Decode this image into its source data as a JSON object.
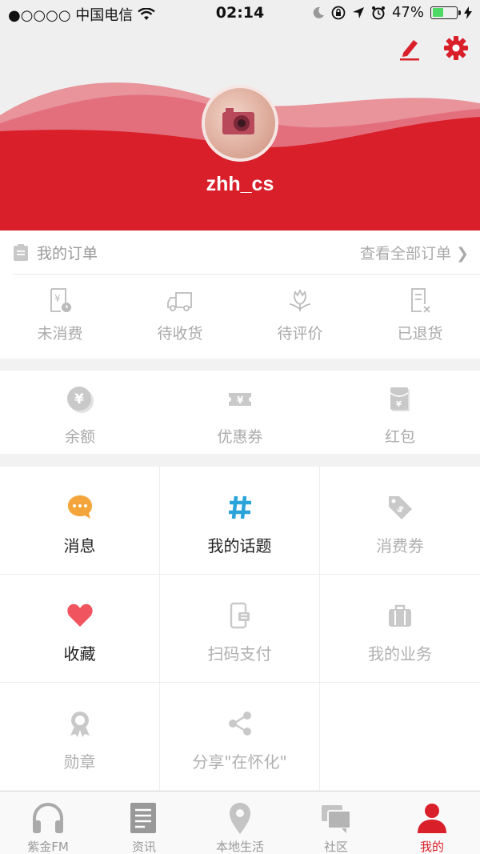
{
  "status_bar": {
    "carrier": "●○○○○ 中国电信",
    "time": "02:14",
    "battery_percent": "47%",
    "battery_level": 0.47
  },
  "profile": {
    "username": "zhh_cs",
    "brand_color": "#d91f2a"
  },
  "orders": {
    "title": "我的订单",
    "view_all": "查看全部订单",
    "items": [
      {
        "label": "未消费",
        "icon": "receipt-clock-icon"
      },
      {
        "label": "待收货",
        "icon": "delivery-truck-icon"
      },
      {
        "label": "待评价",
        "icon": "flower-review-icon"
      },
      {
        "label": "已退货",
        "icon": "returned-doc-icon"
      }
    ]
  },
  "wallet": {
    "items": [
      {
        "label": "余额",
        "icon": "yuan-coin-icon"
      },
      {
        "label": "优惠券",
        "icon": "coupon-icon"
      },
      {
        "label": "红包",
        "icon": "red-envelope-icon"
      }
    ]
  },
  "services": {
    "items": [
      {
        "label": "消息",
        "icon": "message-bubble-icon"
      },
      {
        "label": "我的话题",
        "icon": "hashtag-icon"
      },
      {
        "label": "消费券",
        "icon": "price-tag-icon"
      },
      {
        "label": "收藏",
        "icon": "heart-icon"
      },
      {
        "label": "扫码支付",
        "icon": "scan-pay-icon"
      },
      {
        "label": "我的业务",
        "icon": "briefcase-icon"
      },
      {
        "label": "勋章",
        "icon": "medal-icon"
      },
      {
        "label": "分享\"在怀化\"",
        "icon": "share-icon"
      }
    ]
  },
  "tabbar": {
    "items": [
      {
        "label": "紫金FM",
        "icon": "headphones-icon"
      },
      {
        "label": "资讯",
        "icon": "newspaper-icon"
      },
      {
        "label": "本地生活",
        "icon": "location-pin-icon"
      },
      {
        "label": "社区",
        "icon": "chat-bubbles-icon"
      },
      {
        "label": "我的",
        "icon": "person-icon",
        "active": true
      }
    ]
  }
}
